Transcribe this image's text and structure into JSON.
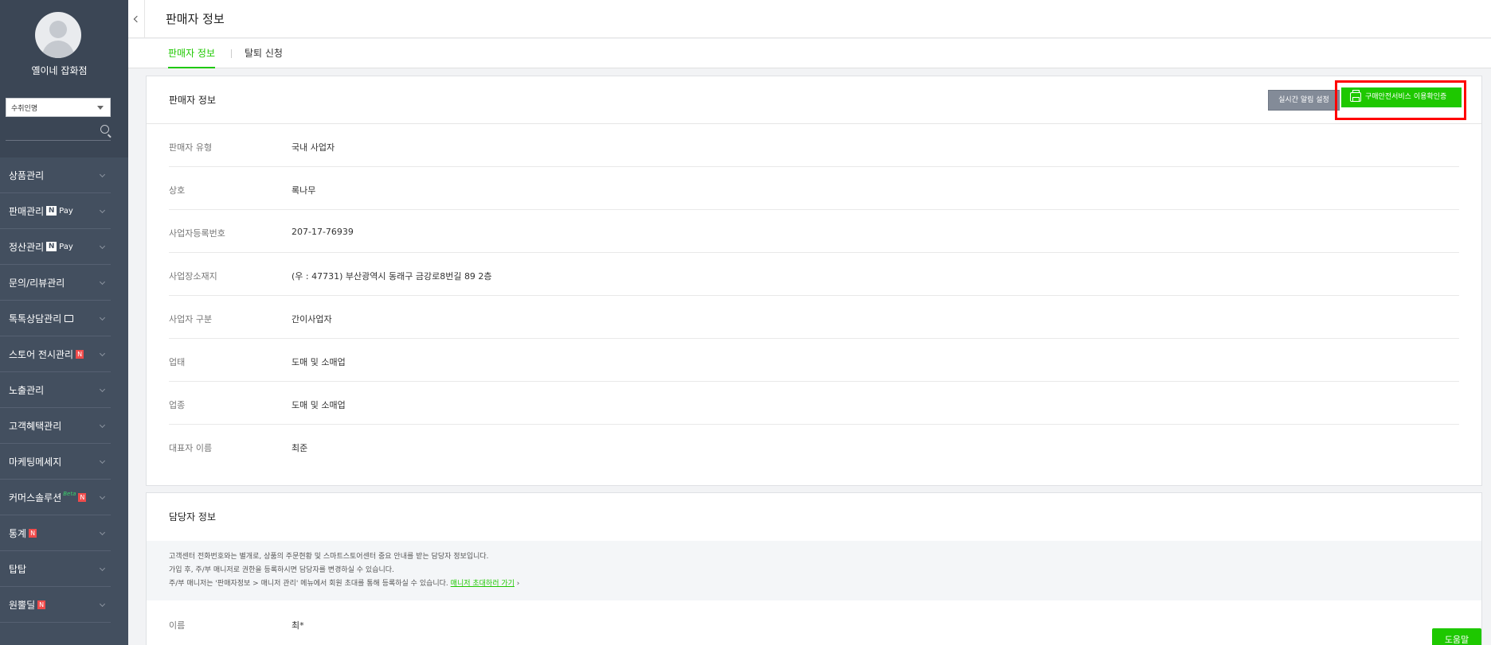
{
  "sidebar": {
    "store_name": "옐이네 잡화점",
    "role_select": "수취인명",
    "items": [
      {
        "label": "상품관리"
      },
      {
        "label": "판매관리",
        "pay": "Pay"
      },
      {
        "label": "정산관리",
        "pay": "Pay"
      },
      {
        "label": "문의/리뷰관리"
      },
      {
        "label": "톡톡상담관리"
      },
      {
        "label": "스토어 전시관리",
        "badge": "N"
      },
      {
        "label": "노출관리"
      },
      {
        "label": "고객혜택관리"
      },
      {
        "label": "마케팅메세지"
      },
      {
        "label": "커머스솔루션",
        "beta": "Beta",
        "badge": "N"
      },
      {
        "label": "통계",
        "badge": "N"
      },
      {
        "label": "탑탑"
      },
      {
        "label": "원뿔딜",
        "badge": "N"
      }
    ]
  },
  "header": {
    "title": "판매자 정보"
  },
  "tabs": [
    {
      "label": "판매자 정보",
      "active": true
    },
    {
      "label": "탈퇴 신청",
      "active": false
    }
  ],
  "seller_card": {
    "title": "판매자 정보",
    "alert_button": "실시간 알림 설정",
    "certificate_button": "구매안전서비스 이용확인증",
    "rows": [
      {
        "label": "판매자 유형",
        "value": "국내 사업자"
      },
      {
        "label": "상호",
        "value": "록나무"
      },
      {
        "label": "사업자등록번호",
        "value": "207-17-76939"
      },
      {
        "label": "사업장소재지",
        "value": "(우 : 47731) 부산광역시 동래구 금강로8번길 89 2층"
      },
      {
        "label": "사업자 구분",
        "value": "간이사업자"
      },
      {
        "label": "업태",
        "value": "도매 및 소매업"
      },
      {
        "label": "업종",
        "value": "도매 및 소매업"
      },
      {
        "label": "대표자 이름",
        "value": "최준"
      }
    ]
  },
  "contact_card": {
    "title": "담당자 정보",
    "notice_lines": [
      "고객센터 전화번호와는 별개로, 상품의 주문현황 및 스마트스토어센터 중요 안내를 받는 담당자 정보입니다.",
      "가입 후, 주/부 매니저로 권한을 등록하시면 담당자를 변경하실 수 있습니다.",
      "주/부 매니저는 '판매자정보 > 매니저 관리' 메뉴에서 회원 초대를 통해 등록하실 수 있습니다."
    ],
    "notice_link": "매니저 초대하러 가기",
    "name_label": "이름",
    "name_value": "최*"
  },
  "help_button": "도움말",
  "colors": {
    "accent": "#1ec800",
    "sidebar": "#3b4655",
    "highlight": "#ff0000"
  }
}
